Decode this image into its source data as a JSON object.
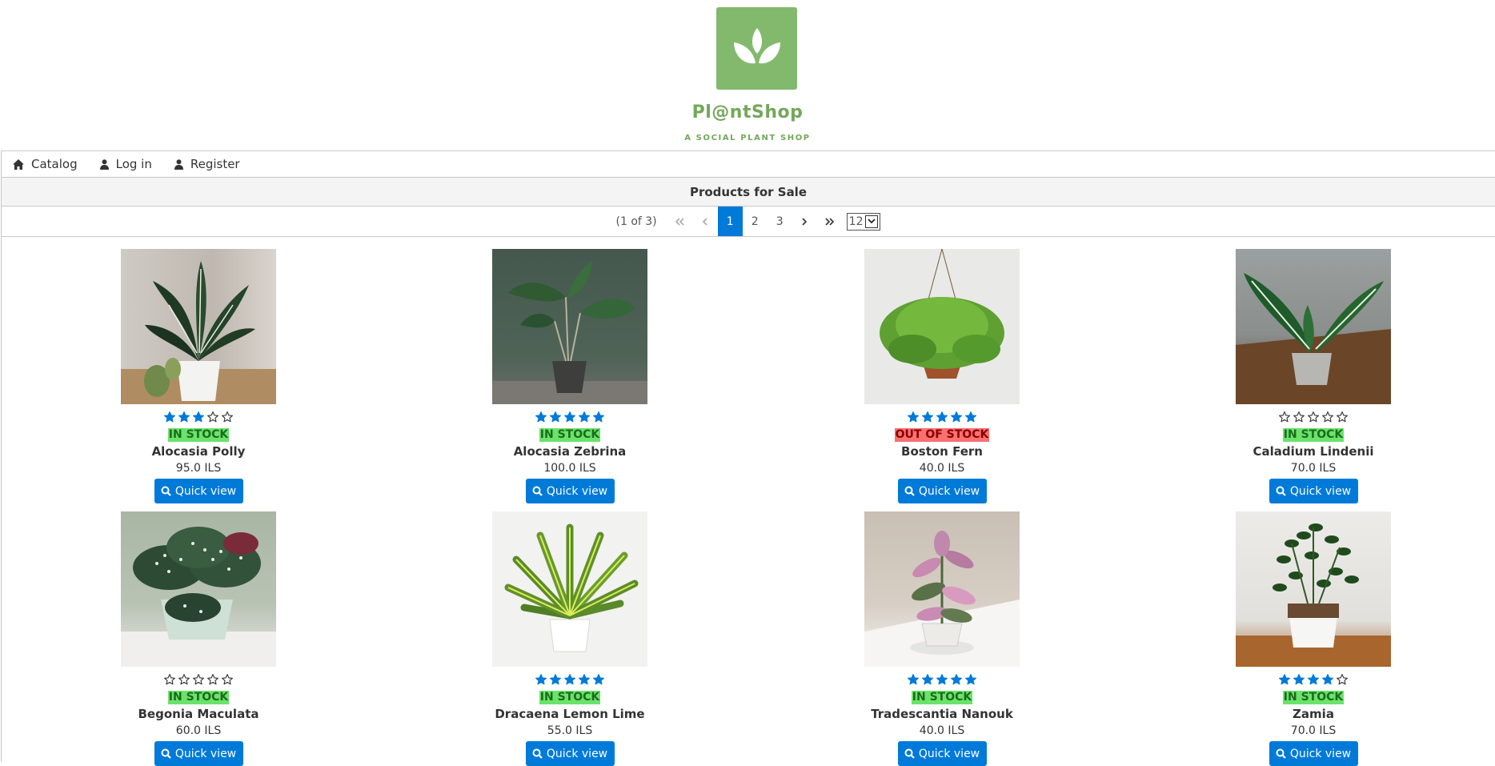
{
  "brand": {
    "name": "Pl@ntShop",
    "tagline": "A SOCIAL PLANT SHOP"
  },
  "menu": {
    "items": [
      {
        "label": "Catalog",
        "icon": "home-icon"
      },
      {
        "label": "Log in",
        "icon": "user-icon"
      },
      {
        "label": "Register",
        "icon": "user-icon"
      }
    ]
  },
  "panel": {
    "title": "Products for Sale"
  },
  "paginator": {
    "report": "(1 of 3)",
    "pages": [
      "1",
      "2",
      "3"
    ],
    "current_page": "1",
    "rows_per_page": "12"
  },
  "products": [
    {
      "name": "Alocasia Polly",
      "price": "95.0 ILS",
      "stock": "IN STOCK",
      "in_stock": true,
      "rating": 3,
      "button": "Quick view"
    },
    {
      "name": "Alocasia Zebrina",
      "price": "100.0 ILS",
      "stock": "IN STOCK",
      "in_stock": true,
      "rating": 5,
      "button": "Quick view"
    },
    {
      "name": "Boston Fern",
      "price": "40.0 ILS",
      "stock": "OUT OF STOCK",
      "in_stock": false,
      "rating": 5,
      "button": "Quick view"
    },
    {
      "name": "Caladium Lindenii",
      "price": "70.0 ILS",
      "stock": "IN STOCK",
      "in_stock": true,
      "rating": 0,
      "button": "Quick view"
    },
    {
      "name": "Begonia Maculata",
      "price": "60.0 ILS",
      "stock": "IN STOCK",
      "in_stock": true,
      "rating": 0,
      "button": "Quick view"
    },
    {
      "name": "Dracaena Lemon Lime",
      "price": "55.0 ILS",
      "stock": "IN STOCK",
      "in_stock": true,
      "rating": 5,
      "button": "Quick view"
    },
    {
      "name": "Tradescantia Nanouk",
      "price": "40.0 ILS",
      "stock": "IN STOCK",
      "in_stock": true,
      "rating": 5,
      "button": "Quick view"
    },
    {
      "name": "Zamia",
      "price": "70.0 ILS",
      "stock": "IN STOCK",
      "in_stock": true,
      "rating": 4,
      "button": "Quick view"
    }
  ],
  "colors": {
    "brand_green": "#83b96c",
    "primary_blue": "#007ad9",
    "in_stock_bg": "#6ae36a",
    "out_of_stock_bg": "#f87070"
  }
}
